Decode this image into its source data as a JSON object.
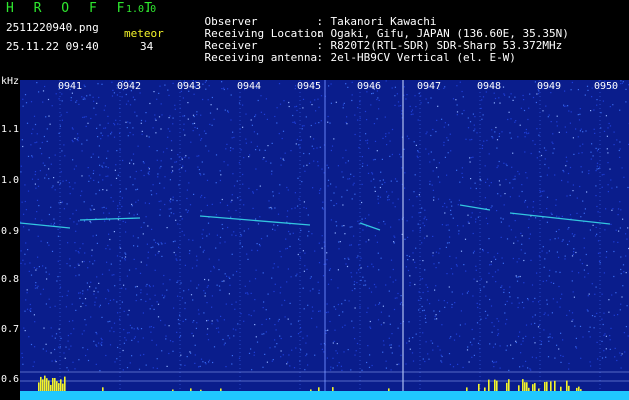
{
  "header": {
    "app_title": "H R O F F T",
    "app_version": "1.0.0",
    "file_name": "2511220940.png",
    "meteor_label": "meteor",
    "date_time": "25.11.22 09:40",
    "meteor_count": "34"
  },
  "info": [
    {
      "label": "Observer",
      "value": "Takanori Kawachi"
    },
    {
      "label": "Receiving Location",
      "value": "Ogaki, Gifu, JAPAN (136.60E, 35.35N)"
    },
    {
      "label": "Receiver",
      "value": "R820T2(RTL-SDR) SDR-Sharp 53.372MHz"
    },
    {
      "label": "Receiving antenna",
      "value": "2el-HB9CV Vertical (el. E-W)"
    }
  ],
  "axis": {
    "unit": "kHz",
    "freq_labels": [
      "1.1",
      "1.0",
      "0.9",
      "0.8",
      "0.7",
      "0.6"
    ],
    "time_labels": [
      "0941",
      "0942",
      "0943",
      "0944",
      "0945",
      "0946",
      "0947",
      "0948",
      "0949",
      "0950"
    ]
  },
  "colors": {
    "title": "#2fe82f",
    "time_labels": "#f4f42a",
    "background": "#0a1d8c",
    "signal": "#37d8e8",
    "level_bar": "#f4f42a",
    "baseline": "#20c8ff"
  }
}
